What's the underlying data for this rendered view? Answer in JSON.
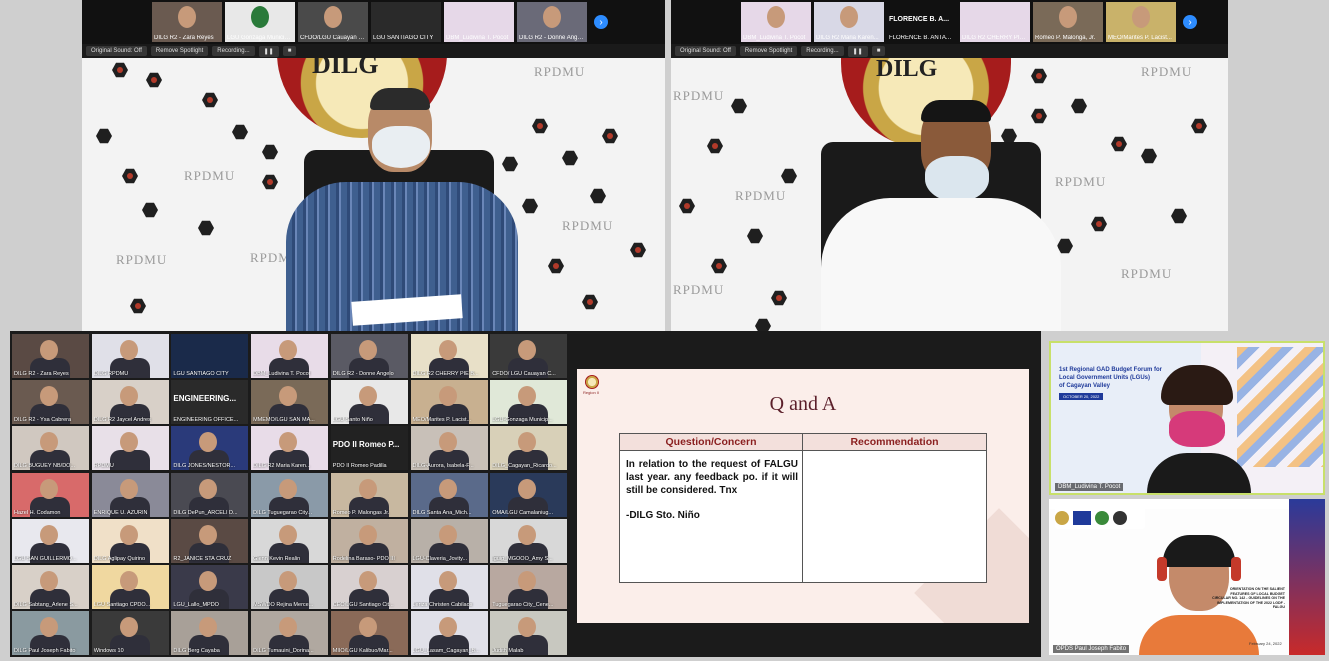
{
  "top_left": {
    "strip_names": [
      "DILG R2 - Zara Reyes",
      "LGU Gonzaga Municipality",
      "CFDO/LGU Cauayan C...",
      "LGU SANTIAGO CITY",
      "DBM_Ludivina T. Pocot",
      "DILG R2 - Donne Angelo..."
    ],
    "controls": [
      "Original Sound: Off",
      "Remove Spotlight",
      "Recording..."
    ],
    "seal_text": "DILG",
    "watermark": "RPDMU"
  },
  "top_right": {
    "strip_names": [
      "DBM_Ludivina T. Pocot",
      "DILG R2 Maria Karen...",
      "FLORENCE B. ANTAYOG",
      "DILG R2 CHERRY PIE B...",
      "Romeo P. Malonga, Jr.",
      "MEO/Marites P. Lacist..."
    ],
    "featured_name": "FLORENCE B. A...",
    "controls": [
      "Original Sound: Off",
      "Remove Spotlight",
      "Recording..."
    ],
    "seal_text": "DILG",
    "watermark": "RPDMU"
  },
  "gallery": {
    "tiles": [
      "DILG R2 - Zara Reyes",
      "DILG RPDMU",
      "LGU SANTIAGO CITY",
      "DBM_Ludivina T. Pocot",
      "DILG R2 - Donne Angelo",
      "DILG R2 CHERRY PIE B...",
      "CFDO/ LGU Cauayan C...",
      "DILG R2 - Ysa Cabrera",
      "DILG R2 Jaycel Andres",
      "ENGINEERING OFFICE...",
      "MMEMO/LGU SAN MA...",
      "LGU Santo Niño",
      "MEO/Marites P. Lacist...",
      "LGU-Gonzaga Municip...",
      "DILG BUGUEY NB/DO...",
      "RPDMU",
      "DILG JONES/NESTOR...",
      "DILG R2 Maria Karen...",
      "PDO II Romeo Padilla",
      "DILG-Aurora, Isabela-F...",
      "DILG_Cagayan_Ricardo...",
      "Hazel H. Codamon",
      "ENRIQUE U. AZURIN",
      "DILG DePun_ARCELI D...",
      "DILG Tuguegarao City...",
      "Romeo P. Malongas Jr.",
      "DILG Santa Ana_Mich...",
      "OMA/LGU Camalaniug...",
      "LGU SAN GUILLERMO...",
      "DILG Aglipay Quirino",
      "R2_JANICE STA CRUZ",
      "Glenn Kevin Realin",
      "Rodelina Baraso- PDO III",
      "LGU-Claveria_Jovity...",
      "Iguig_MGOOO_Amy S...",
      "DILG Sabtang_Arlene S...",
      "LGU Santiago CPDO...",
      "LGU_Lallo_MPDO",
      "MSWDO Rejina Merce...",
      "CEO/LGU Santiago Cit...",
      "Leriza Christen Cabilaos",
      "Tuguegarao City_Cene...",
      "DILG Paul Joseph Fabito",
      "Windows 10",
      "DILG Berg Cayaba",
      "DILG Tumauini_Dorina...",
      "MIIO/LGU Kalibuo/Mar...",
      "LGU_Lasam_Cagayan_B...",
      "Judith Malab"
    ],
    "big_labels": {
      "9": "ENGINEERING...",
      "18": "PDO II Romeo P..."
    }
  },
  "slide": {
    "region_label": "Region II",
    "title": "Q and A",
    "col1": "Question/Concern",
    "col2": "Recommendation",
    "question": "In relation to the request of FALGU last year. any feedback po. if it will still be considered. Tnx",
    "signature": "-DILG Sto. Niño"
  },
  "right_top": {
    "poster_line1": "1st Regional GAD Budget Forum for",
    "poster_line2": "Local Government Units (LGUs)",
    "poster_line3": "of Cagayan Valley",
    "poster_date": "OCTOBER 20, 2022",
    "name": "DBM_Ludivina T. Pocot"
  },
  "right_bottom": {
    "orientation_text": "ORIENTATION ON THE SALIENT FEATURES OF LOCAL BUDGET CIRCULAR NO. 142 - GUIDELINES ON THE IMPLEMENTATION OF THE 2022 LGDF - FALGU",
    "date": "February 24, 2022",
    "name": "OPDS Paul Joseph Fabito"
  },
  "colors": {
    "accent_blue": "#2d8cff",
    "maroon": "#5b1f2a",
    "dark_bg": "#1b1b1b"
  }
}
